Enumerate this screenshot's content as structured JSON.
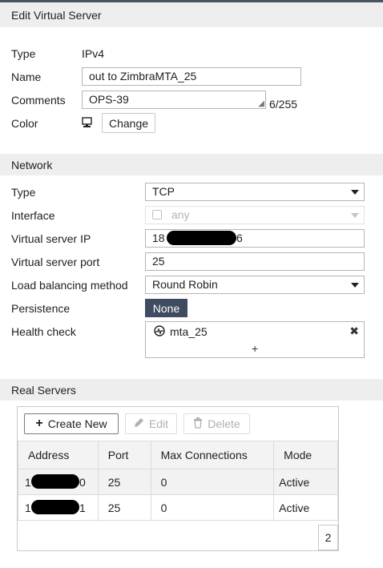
{
  "edit_header": {
    "title": "Edit Virtual Server"
  },
  "general": {
    "type_label": "Type",
    "type_value": "IPv4",
    "name_label": "Name",
    "name_value": "out to ZimbraMTA_25",
    "comments_label": "Comments",
    "comments_value": "OPS-39",
    "comments_count": "6/255",
    "color_label": "Color",
    "color_icon": "monitor-icon",
    "change_button": "Change"
  },
  "network": {
    "header": "Network",
    "type_label": "Type",
    "type_value": "TCP",
    "interface_label": "Interface",
    "interface_value": "any",
    "vs_ip_label": "Virtual server IP",
    "vs_ip_prefix": "18",
    "vs_ip_suffix": "6",
    "vs_port_label": "Virtual server port",
    "vs_port_value": "25",
    "lb_label": "Load balancing method",
    "lb_value": "Round Robin",
    "persistence_label": "Persistence",
    "persistence_value": "None",
    "health_label": "Health check",
    "health_item": "mta_25",
    "health_add": "+",
    "health_remove": "✖"
  },
  "real_servers": {
    "header": "Real Servers",
    "toolbar": {
      "create_new": "Create New",
      "edit": "Edit",
      "delete": "Delete"
    },
    "columns": [
      "Address",
      "Port",
      "Max Connections",
      "Mode"
    ],
    "rows": [
      {
        "addr_prefix": "1",
        "addr_suffix": "0",
        "port": "25",
        "max_conn": "0",
        "mode": "Active"
      },
      {
        "addr_prefix": "1",
        "addr_suffix": "1",
        "port": "25",
        "max_conn": "0",
        "mode": "Active"
      }
    ],
    "count": "2"
  },
  "colors": {
    "header_bg": "#eeeeee",
    "persistence_bg": "#3f4b60",
    "disabled_text": "#b3b3b3",
    "row_selected_bg": "#f2f2f2"
  }
}
